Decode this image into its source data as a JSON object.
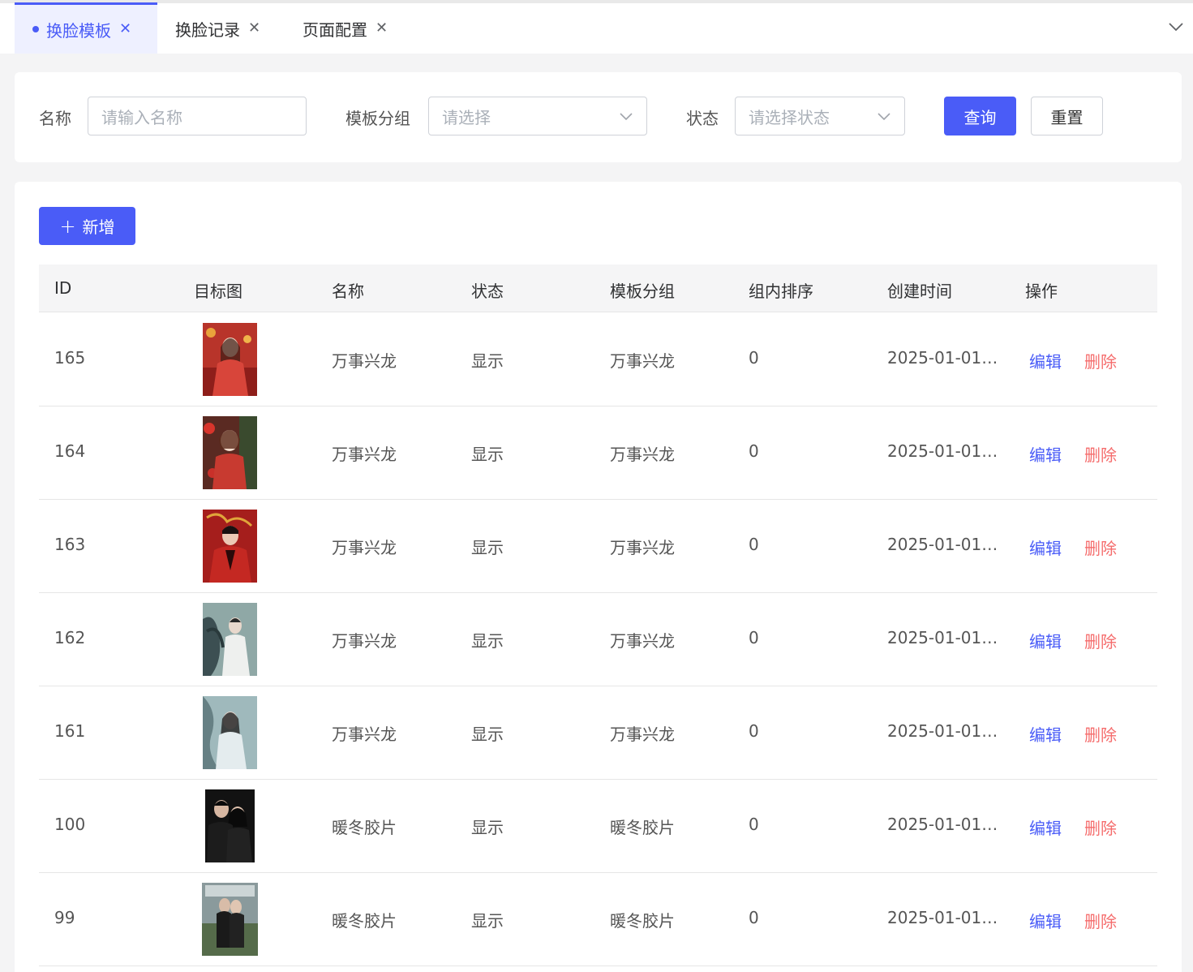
{
  "tabs": [
    {
      "label": "换脸模板",
      "active": true
    },
    {
      "label": "换脸记录",
      "active": false
    },
    {
      "label": "页面配置",
      "active": false
    }
  ],
  "filter": {
    "name_label": "名称",
    "name_placeholder": "请输入名称",
    "group_label": "模板分组",
    "group_placeholder": "请选择",
    "status_label": "状态",
    "status_placeholder": "请选择状态",
    "query_label": "查询",
    "reset_label": "重置"
  },
  "toolbar": {
    "add_label": "新增"
  },
  "table": {
    "headers": [
      "ID",
      "目标图",
      "名称",
      "状态",
      "模板分组",
      "组内排序",
      "创建时间",
      "操作"
    ],
    "edit_label": "编辑",
    "delete_label": "删除",
    "rows": [
      {
        "id": "165",
        "name": "万事兴龙",
        "status": "显示",
        "group": "万事兴龙",
        "sort": "0",
        "created": "2025-01-01…"
      },
      {
        "id": "164",
        "name": "万事兴龙",
        "status": "显示",
        "group": "万事兴龙",
        "sort": "0",
        "created": "2025-01-01…"
      },
      {
        "id": "163",
        "name": "万事兴龙",
        "status": "显示",
        "group": "万事兴龙",
        "sort": "0",
        "created": "2025-01-01…"
      },
      {
        "id": "162",
        "name": "万事兴龙",
        "status": "显示",
        "group": "万事兴龙",
        "sort": "0",
        "created": "2025-01-01…"
      },
      {
        "id": "161",
        "name": "万事兴龙",
        "status": "显示",
        "group": "万事兴龙",
        "sort": "0",
        "created": "2025-01-01…"
      },
      {
        "id": "100",
        "name": "暖冬胶片",
        "status": "显示",
        "group": "暖冬胶片",
        "sort": "0",
        "created": "2025-01-01…"
      },
      {
        "id": "99",
        "name": "暖冬胶片",
        "status": "显示",
        "group": "暖冬胶片",
        "sort": "0",
        "created": "2025-01-01…"
      }
    ]
  },
  "colors": {
    "primary": "#4a5cf7",
    "danger": "#f56c6c"
  }
}
